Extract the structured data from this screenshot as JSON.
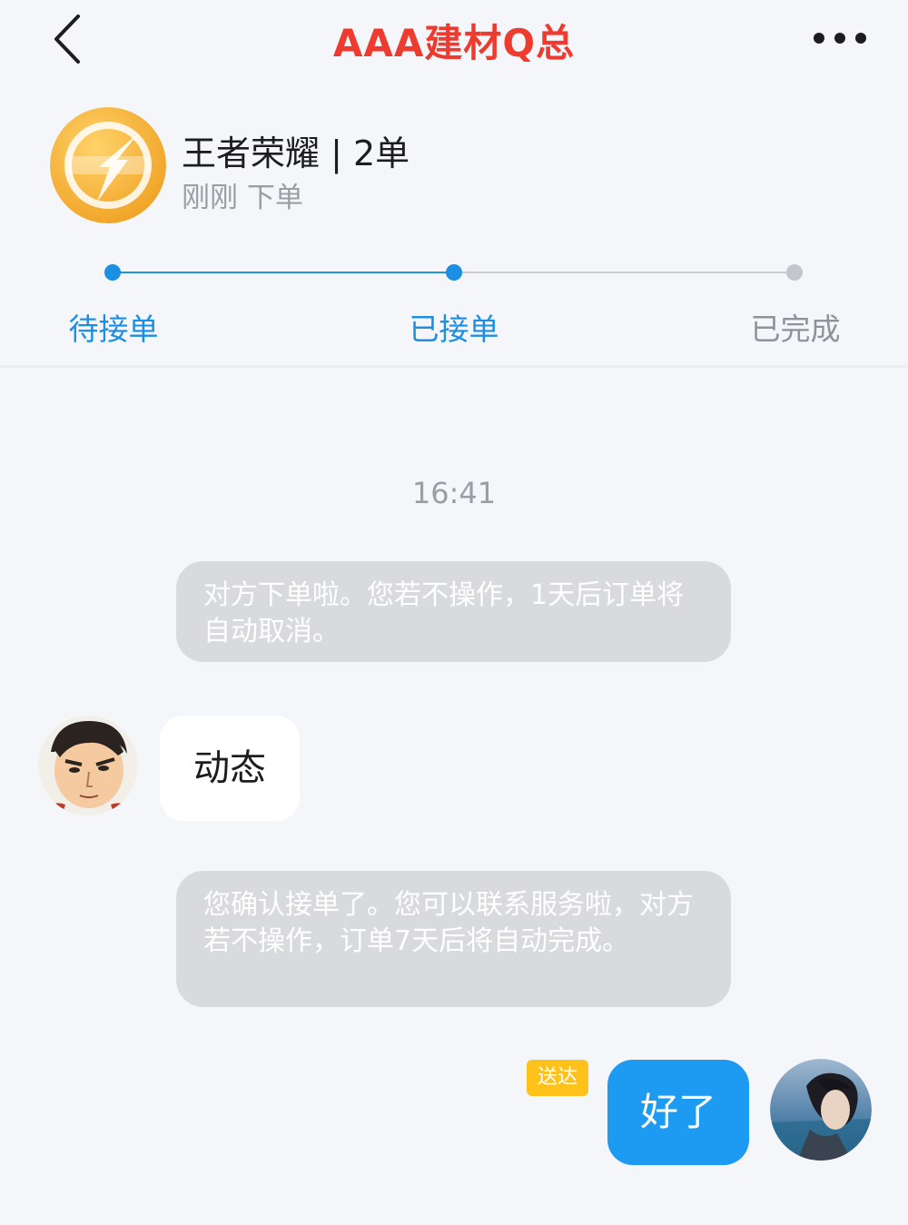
{
  "header": {
    "title": "AAA建材Q总",
    "back_icon": "chevron-left-icon",
    "more_icon": "more-dots-icon"
  },
  "order": {
    "logo_icon": "game-logo-icon",
    "title": "王者荣耀 | 2单",
    "subtitle": "刚刚 下单"
  },
  "steps": [
    {
      "label": "待接单",
      "done": true
    },
    {
      "label": "已接单",
      "done": true
    },
    {
      "label": "已完成",
      "done": false
    }
  ],
  "chat": {
    "timestamp": "16:41",
    "system_message_1": "对方下单啦。您若不操作，1天后订单将自动取消。",
    "incoming_message": "动态",
    "system_message_2": "您确认接单了。您可以联系服务啦，对方若不操作，订单7天后将自动完成。",
    "outgoing_status": "送达",
    "outgoing_message": "好了"
  },
  "colors": {
    "title": "#ee3b2f",
    "accent": "#1c8fe3",
    "outgoing_bubble": "#1d9af2",
    "delivered_badge": "#ffc21b"
  }
}
